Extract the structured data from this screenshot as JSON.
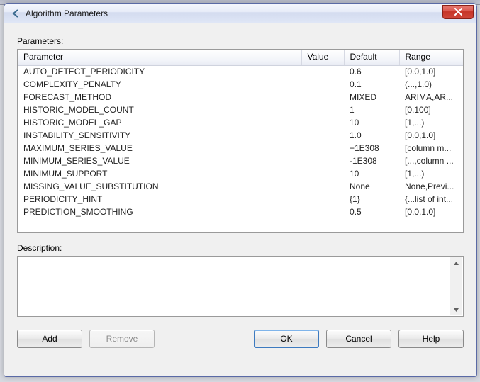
{
  "window": {
    "title": "Algorithm Parameters"
  },
  "labels": {
    "parameters": "Parameters:",
    "description": "Description:"
  },
  "columns": {
    "parameter": "Parameter",
    "value": "Value",
    "default": "Default",
    "range": "Range"
  },
  "rows": [
    {
      "parameter": "AUTO_DETECT_PERIODICITY",
      "value": "",
      "default": "0.6",
      "range": "[0.0,1.0]"
    },
    {
      "parameter": "COMPLEXITY_PENALTY",
      "value": "",
      "default": "0.1",
      "range": "(...,1.0)"
    },
    {
      "parameter": "FORECAST_METHOD",
      "value": "",
      "default": "MIXED",
      "range": "ARIMA,AR..."
    },
    {
      "parameter": "HISTORIC_MODEL_COUNT",
      "value": "",
      "default": "1",
      "range": "[0,100]"
    },
    {
      "parameter": "HISTORIC_MODEL_GAP",
      "value": "",
      "default": "10",
      "range": "[1,...)"
    },
    {
      "parameter": "INSTABILITY_SENSITIVITY",
      "value": "",
      "default": "1.0",
      "range": "[0.0,1.0]"
    },
    {
      "parameter": "MAXIMUM_SERIES_VALUE",
      "value": "",
      "default": "+1E308",
      "range": "[column m..."
    },
    {
      "parameter": "MINIMUM_SERIES_VALUE",
      "value": "",
      "default": "-1E308",
      "range": "[...,column ..."
    },
    {
      "parameter": "MINIMUM_SUPPORT",
      "value": "",
      "default": "10",
      "range": "[1,...)"
    },
    {
      "parameter": "MISSING_VALUE_SUBSTITUTION",
      "value": "",
      "default": "None",
      "range": "None,Previ..."
    },
    {
      "parameter": "PERIODICITY_HINT",
      "value": "",
      "default": "{1}",
      "range": "{...list of int..."
    },
    {
      "parameter": "PREDICTION_SMOOTHING",
      "value": "",
      "default": "0.5",
      "range": "[0.0,1.0]"
    }
  ],
  "description": {
    "text": ""
  },
  "buttons": {
    "add": "Add",
    "remove": "Remove",
    "ok": "OK",
    "cancel": "Cancel",
    "help": "Help"
  }
}
